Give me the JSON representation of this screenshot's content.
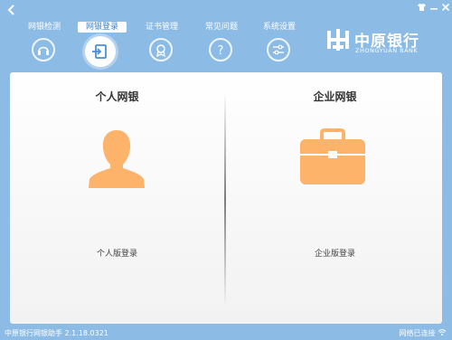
{
  "titlebar": {
    "back_icon": "back-arrow-icon",
    "controls": [
      "shirt-icon",
      "minimize-icon",
      "close-icon"
    ]
  },
  "nav": {
    "items": [
      {
        "label": "网银检测",
        "icon": "headset-icon",
        "active": false
      },
      {
        "label": "网银登录",
        "icon": "login-door-icon",
        "active": true
      },
      {
        "label": "证书管理",
        "icon": "certificate-icon",
        "active": false
      },
      {
        "label": "常见问题",
        "icon": "question-icon",
        "active": false
      },
      {
        "label": "系统设置",
        "icon": "settings-sliders-icon",
        "active": false
      }
    ]
  },
  "logo": {
    "cn": "中原银行",
    "en": "ZHONGYUAN BANK"
  },
  "personal": {
    "title": "个人网银",
    "link": "个人版登录",
    "icon": "person-icon"
  },
  "enterprise": {
    "title": "企业网银",
    "link": "企业版登录",
    "icon": "briefcase-icon"
  },
  "colors": {
    "accent": "#8cbbe5",
    "icon_orange": "#fdb36a"
  },
  "status": {
    "version": "中原银行网银助手 2.1.18.0321",
    "network": "网络已连接"
  }
}
